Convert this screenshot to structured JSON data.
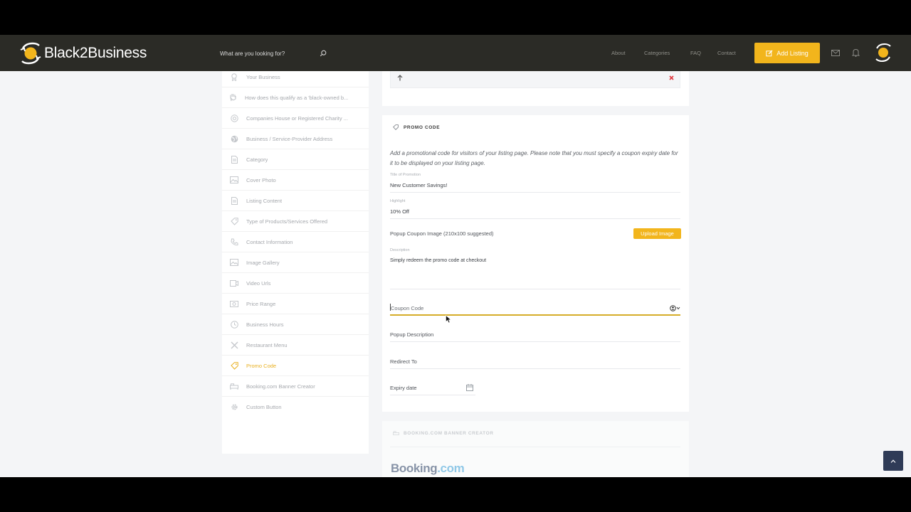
{
  "header": {
    "brand": "Black2Business",
    "search_placeholder": "What are you looking for?",
    "nav": [
      "About",
      "Categories",
      "FAQ",
      "Contact"
    ],
    "add_listing": "Add Listing"
  },
  "sidebar": {
    "items": [
      {
        "label": "Your Business",
        "icon": "award-icon"
      },
      {
        "label": "How does this qualify as a 'black-owned b...",
        "icon": "hand-icon"
      },
      {
        "label": "Companies House or Registered Charity ...",
        "icon": "registered-icon"
      },
      {
        "label": "Business / Service-Provider Address",
        "icon": "globe-icon"
      },
      {
        "label": "Category",
        "icon": "document-icon"
      },
      {
        "label": "Cover Photo",
        "icon": "image-icon"
      },
      {
        "label": "Listing Content",
        "icon": "document-icon"
      },
      {
        "label": "Type of Products/Services Offered",
        "icon": "tag-icon"
      },
      {
        "label": "Contact Information",
        "icon": "phone-icon"
      },
      {
        "label": "Image Gallery",
        "icon": "gallery-icon"
      },
      {
        "label": "Video Urls",
        "icon": "video-icon"
      },
      {
        "label": "Price Range",
        "icon": "money-icon"
      },
      {
        "label": "Business Hours",
        "icon": "clock-icon"
      },
      {
        "label": "Restaurant Menu",
        "icon": "utensils-icon"
      },
      {
        "label": "Promo Code",
        "icon": "tag-icon",
        "active": true
      },
      {
        "label": "Booking.com Banner Creator",
        "icon": "bed-icon"
      },
      {
        "label": "Custom Button",
        "icon": "gear-icon"
      }
    ]
  },
  "promo": {
    "title": "PROMO CODE",
    "intro": "Add a promotional code for visitors of your listing page. Please note that you must specify a coupon expiry date for it to be displayed on your listing page.",
    "title_label": "Title of Promotion",
    "title_value": "New Customer Savings!",
    "highlight_label": "Highlight",
    "highlight_value": "10% Off",
    "popup_image_label": "Popup Coupon Image (210x100 suggested)",
    "upload_button": "Upload Image",
    "description_label": "Description",
    "description_value": "Simply redeem the promo code at checkout",
    "coupon_code": "Coupon Code",
    "popup_description": "Popup Description",
    "redirect_to": "Redirect To",
    "expiry_date": "Expiry date"
  },
  "booking": {
    "title": "BOOKING.COM BANNER CREATOR",
    "logo_text_1": "Booking",
    "logo_text_2": ".com"
  },
  "colors": {
    "accent": "#f2b51c",
    "header_bg": "#2b2b26",
    "page_bg": "#f4f5f7"
  }
}
